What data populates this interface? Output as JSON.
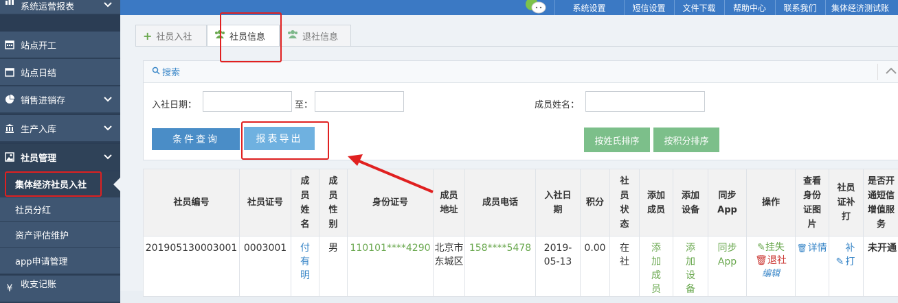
{
  "sidebar": {
    "items": [
      {
        "label": "系统运营报表",
        "icon": "bar-chart-icon"
      },
      {
        "label": "站点开工",
        "icon": "calendar-icon"
      },
      {
        "label": "站点日结",
        "icon": "calendar-icon"
      },
      {
        "label": "销售进销存",
        "icon": "pie-chart-icon"
      },
      {
        "label": "生产入库",
        "icon": "bank-icon"
      },
      {
        "label": "社员管理",
        "icon": "picture-icon"
      },
      {
        "label": "收支记账",
        "icon": "yen-icon"
      }
    ],
    "subitems": [
      {
        "label": "集体经济社员入社"
      },
      {
        "label": "社员分红"
      },
      {
        "label": "资产评估维护"
      },
      {
        "label": "app申请管理"
      }
    ]
  },
  "topbar": {
    "items": [
      "系统设置",
      "短信设置",
      "文件下载",
      "帮助中心",
      "联系我们",
      "集体经济测试账"
    ]
  },
  "tabs": [
    {
      "label": "社员入社",
      "icon": "plus-icon"
    },
    {
      "label": "社员信息",
      "icon": "users-icon"
    },
    {
      "label": "退社信息",
      "icon": "users-icon"
    }
  ],
  "search": {
    "title": "搜索",
    "date_label": "入社日期：",
    "to_label": "至：",
    "name_label": "成员姓名：",
    "query_button": "条件查询",
    "export_button": "报表导出",
    "sort_name_button": "按姓氏排序",
    "sort_points_button": "按积分排序"
  },
  "table": {
    "headers": [
      "社员编号",
      "社员证号",
      "成员姓名",
      "成员性别",
      "身份证号",
      "成员地址",
      "成员电话",
      "入社日期",
      "积分",
      "社员状态",
      "添加成员",
      "添加设备",
      "同步App",
      "操作",
      "查看身份证图片",
      "社员证补打",
      "是否开通短信增值服务"
    ],
    "row": {
      "member_no": "201905130003001",
      "card_no": "0003001",
      "name": "付有明",
      "gender": "男",
      "id_no": "110101****4290",
      "address": "北京市东城区",
      "phone": "158****5478",
      "join_date": "2019-05-13",
      "points": "0.00",
      "status": "在社",
      "add_member": "添加成员",
      "add_device": "添加设备",
      "sync_app": "同步App",
      "op_lost": "挂失",
      "op_quit": "退社",
      "op_edit": "编辑",
      "view_detail": "详情",
      "reprint": "补打",
      "sms_status": "未开通"
    }
  },
  "colors": {
    "sidebar": "#3f5672",
    "topbar": "#3b79c4",
    "query_button": "#4a8dc7",
    "export_button": "#6fb1e0",
    "sort_button": "#7cbf8a",
    "highlight": "#e02020"
  }
}
